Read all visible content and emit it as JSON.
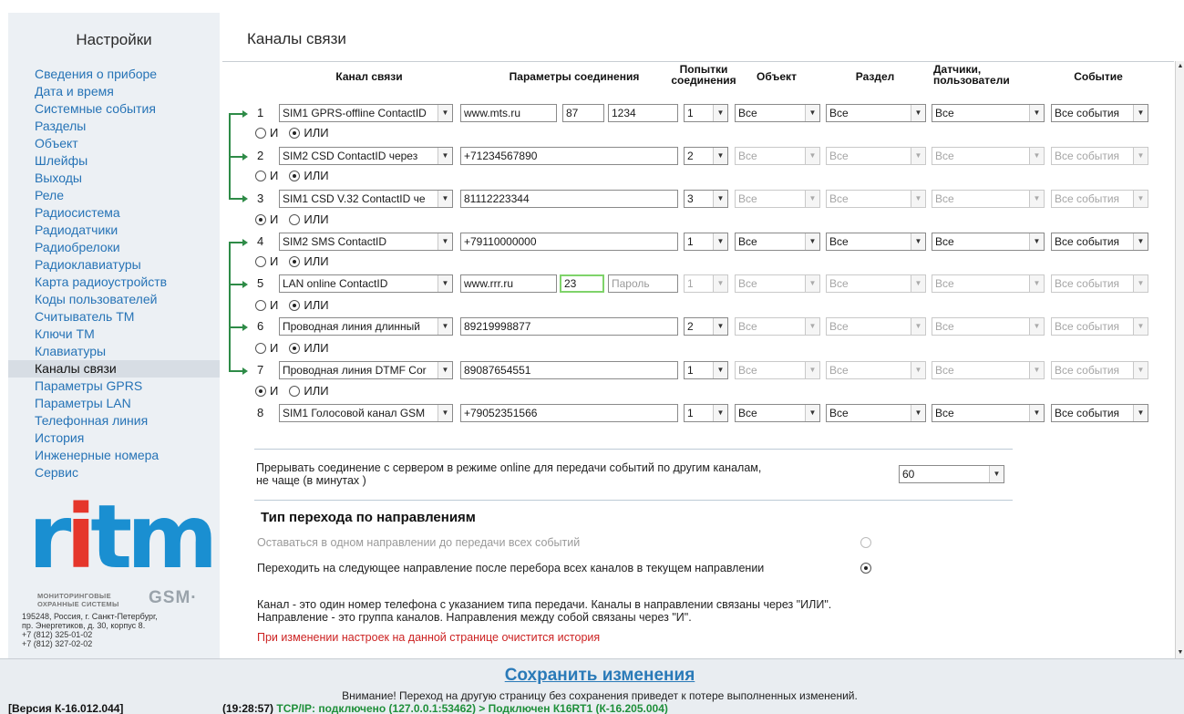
{
  "sidebar": {
    "title": "Настройки",
    "items": [
      {
        "label": "Сведения о приборе"
      },
      {
        "label": "Дата и время"
      },
      {
        "label": "Системные события"
      },
      {
        "label": "Разделы"
      },
      {
        "label": "Объект"
      },
      {
        "label": "Шлейфы"
      },
      {
        "label": "Выходы"
      },
      {
        "label": "Реле"
      },
      {
        "label": "Радиосистема"
      },
      {
        "label": "Радиодатчики"
      },
      {
        "label": "Радиобрелоки"
      },
      {
        "label": "Радиоклавиатуры"
      },
      {
        "label": "Карта радиоустройств"
      },
      {
        "label": "Коды пользователей"
      },
      {
        "label": "Считыватель ТМ"
      },
      {
        "label": "Ключи ТМ"
      },
      {
        "label": "Клавиатуры"
      },
      {
        "label": "Каналы связи",
        "active": true
      },
      {
        "label": "Параметры GPRS"
      },
      {
        "label": "Параметры LAN"
      },
      {
        "label": "Телефонная линия"
      },
      {
        "label": "История"
      },
      {
        "label": "Инженерные номера"
      },
      {
        "label": "Сервис"
      }
    ],
    "logo": {
      "word_a": "r",
      "word_b": "i",
      "word_c": "tm",
      "sub1": "МОНИТОРИНГОВЫЕ",
      "sub2": "ОХРАННЫЕ СИСТЕМЫ",
      "gsm": "GSM·"
    },
    "address": "195248, Россия, г. Санкт-Петербург,\nпр. Энергетиков, д. 30, корпус 8.\n+7 (812) 325-01-02\n+7 (812) 327-02-02"
  },
  "page_title": "Каналы связи",
  "headers": {
    "channel": "Канал связи",
    "params": "Параметры соединения",
    "attempts": "Попытки соединения",
    "object": "Объект",
    "section": "Раздел",
    "sensors": "Датчики, пользователи",
    "event": "Событие"
  },
  "channels": [
    {
      "num": "1",
      "channel": "SIM1 GPRS-offline ContactID",
      "p1": "www.mts.ru",
      "p2": "87",
      "p3": "1234",
      "attempts": "1",
      "object": "Все",
      "section": "Все",
      "sensors": "Все",
      "event": "Все события"
    },
    {
      "num": "2",
      "channel": "SIM2 CSD ContactID через",
      "p1": "+71234567890",
      "attempts": "2",
      "object": "Все",
      "section": "Все",
      "sensors": "Все",
      "event": "Все события"
    },
    {
      "num": "3",
      "channel": "SIM1 CSD V.32 ContactID че",
      "p1": "81112223344",
      "attempts": "3",
      "object": "Все",
      "section": "Все",
      "sensors": "Все",
      "event": "Все события"
    },
    {
      "num": "4",
      "channel": "SIM2 SMS ContactID",
      "p1": "+79110000000",
      "attempts": "1",
      "object": "Все",
      "section": "Все",
      "sensors": "Все",
      "event": "Все события"
    },
    {
      "num": "5",
      "channel": "LAN online ContactID",
      "p1": "www.rrr.ru",
      "p2": "23",
      "p3": "Пароль",
      "attempts": "1",
      "object": "Все",
      "section": "Все",
      "sensors": "Все",
      "event": "Все события"
    },
    {
      "num": "6",
      "channel": "Проводная линия длинный",
      "p1": "89219998877",
      "attempts": "2",
      "object": "Все",
      "section": "Все",
      "sensors": "Все",
      "event": "Все события"
    },
    {
      "num": "7",
      "channel": "Проводная линия DTMF Cor",
      "p1": "89087654551",
      "attempts": "1",
      "object": "Все",
      "section": "Все",
      "sensors": "Все",
      "event": "Все события"
    },
    {
      "num": "8",
      "channel": "SIM1 Голосовой канал GSM",
      "p1": "+79052351566",
      "attempts": "1",
      "object": "Все",
      "section": "Все",
      "sensors": "Все",
      "event": "Все события"
    }
  ],
  "logic": {
    "and": "И",
    "or": "ИЛИ"
  },
  "interrupt": {
    "text1": "Прерывать соединение с сервером в режиме online для передачи событий по другим каналам,",
    "text2": "не чаще (в минутах )",
    "value": "60"
  },
  "transition": {
    "title": "Тип перехода по направлениям",
    "opt1": "Оставаться в одном направлении до передачи всех событий",
    "opt2": "Переходить на следующее направление после перебора  всех каналов в текущем направлении"
  },
  "info": {
    "line1": "Канал - это  один номер телефона с указанием типа передачи. Каналы в направлении связаны через \"ИЛИ\".",
    "line2": "Направление - это группа каналов. Направления между собой связаны через \"И\".",
    "warning": "При изменении настроек на данной странице очистится история"
  },
  "footer": {
    "save": "Сохранить изменения",
    "warning": "Внимание! Переход на другую страницу без сохранения приведет к потере выполненных изменений."
  },
  "status": {
    "version": "[Версия К-16.012.044]",
    "time": "(19:28:57)",
    "connection": "TCP/IP: подключено (127.0.0.1:53462) > Подключен К16RT1 (К-16.205.004)"
  },
  "colors": {
    "link": "#2673b6",
    "accent_green": "#2e8b47",
    "warning_red": "#cc2222"
  }
}
